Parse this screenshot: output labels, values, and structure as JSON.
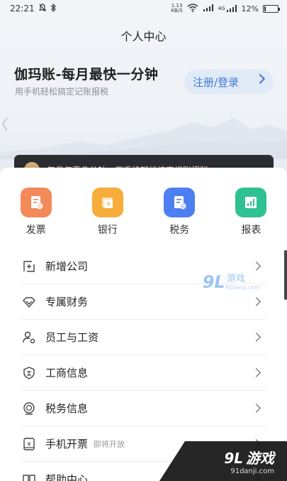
{
  "status": {
    "time": "22:21",
    "net_speed_top": "1.13",
    "net_speed_bottom": "KB/S",
    "signal1": "ᯤ",
    "signal2": "4G",
    "battery": "12%",
    "battery_level": 0.12
  },
  "header": {
    "title": "个人中心",
    "brand_title": "伽玛账-每月最快一分钟",
    "brand_subtitle": "用手机轻松搞定记账报税",
    "login_label": "注册/登录"
  },
  "promo": {
    "badge": "VIP",
    "text": "每月仅需几分钟，用手机轻松搞定记账报税"
  },
  "quick_actions": [
    {
      "label": "发票",
      "color": "#f28a5a"
    },
    {
      "label": "银行",
      "color": "#f6ad3c"
    },
    {
      "label": "税务",
      "color": "#4e7ff1"
    },
    {
      "label": "报表",
      "color": "#2fc192"
    }
  ],
  "menu": [
    {
      "label": "新增公司",
      "note": ""
    },
    {
      "label": "专属财务",
      "note": ""
    },
    {
      "label": "员工与工资",
      "note": ""
    },
    {
      "label": "工商信息",
      "note": ""
    },
    {
      "label": "税务信息",
      "note": ""
    },
    {
      "label": "手机开票",
      "note": "即将开放"
    },
    {
      "label": "帮助中心",
      "note": ""
    }
  ],
  "watermark": {
    "logo": "9L",
    "text": "游戏",
    "url": "91danji.com"
  }
}
